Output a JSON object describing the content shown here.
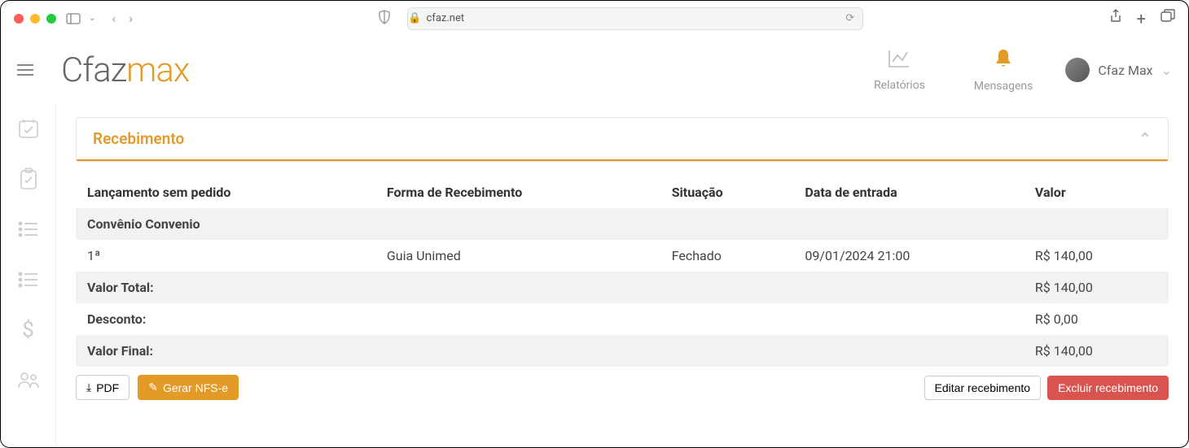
{
  "browser": {
    "url": "cfaz.net"
  },
  "logo": {
    "part1": "Cfaz",
    "part2": "max"
  },
  "topnav": {
    "reports": "Relatórios",
    "messages": "Mensagens"
  },
  "user": {
    "name": "Cfaz Max"
  },
  "panel": {
    "title": "Recebimento"
  },
  "table": {
    "headers": {
      "lancamento": "Lançamento sem pedido",
      "forma": "Forma de Recebimento",
      "situacao": "Situação",
      "data": "Data de entrada",
      "valor": "Valor"
    },
    "group_label": "Convênio Convenio",
    "rows": [
      {
        "lancamento": "1ª",
        "forma": "Guia Unimed",
        "situacao": "Fechado",
        "data": "09/01/2024 21:00",
        "valor": "R$ 140,00"
      }
    ],
    "summary": {
      "total_label": "Valor Total:",
      "total_value": "R$ 140,00",
      "desconto_label": "Desconto:",
      "desconto_value": "R$ 0,00",
      "final_label": "Valor Final:",
      "final_value": "R$ 140,00"
    }
  },
  "buttons": {
    "pdf": "PDF",
    "gerar_nfse": "Gerar NFS-e",
    "editar": "Editar recebimento",
    "excluir": "Excluir recebimento"
  }
}
